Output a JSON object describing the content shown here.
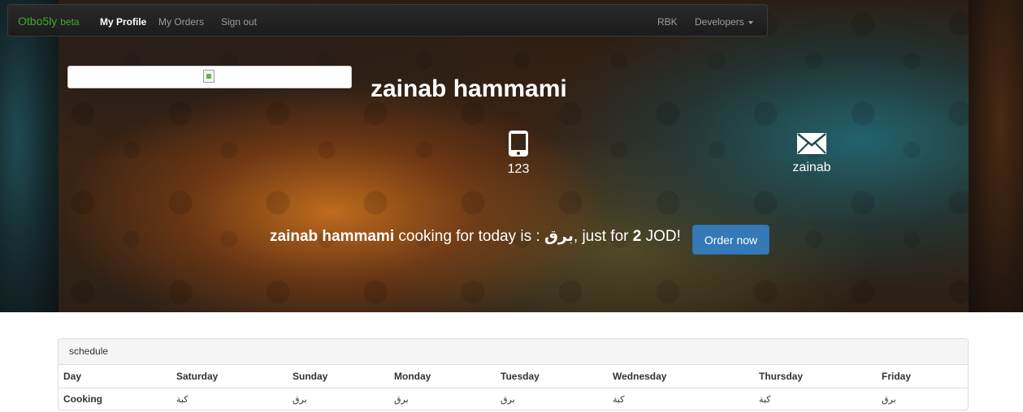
{
  "navbar": {
    "brand": "Otbo5ly",
    "brand_suffix": "beta",
    "links": [
      "My Profile",
      "My Orders",
      "Sign out"
    ],
    "right_links": [
      "RBK",
      "Developers"
    ]
  },
  "profile": {
    "name": "zainab hammami",
    "phone": "123",
    "email": "zainab",
    "phone_icon": "mobile-phone-icon",
    "email_icon": "envelope-icon"
  },
  "today": {
    "cook_name": "zainab hammami",
    "text_prefix": "cooking for today is :",
    "dish": "برق",
    "text_middle": ", just for",
    "price": "2",
    "currency": "JOD!",
    "order_button": "Order now"
  },
  "schedule": {
    "title": "schedule",
    "headers": [
      "Day",
      "Saturday",
      "Sunday",
      "Monday",
      "Tuesday",
      "Wednesday",
      "Thursday",
      "Friday"
    ],
    "row_label": "Cooking",
    "cells": [
      "كبة",
      "برق",
      "برق",
      "برق",
      "كبة",
      "كبة",
      "برق"
    ]
  },
  "colors": {
    "brand": "#3fa92b",
    "order_button": "#337ab7"
  }
}
